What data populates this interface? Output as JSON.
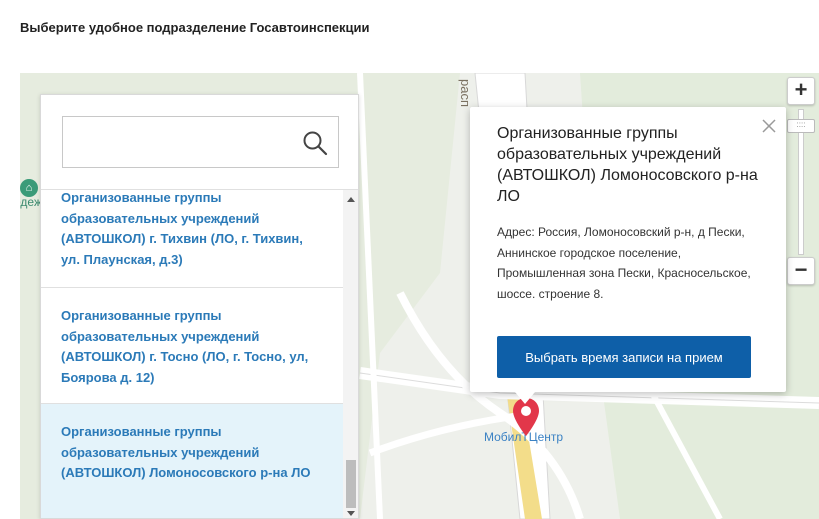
{
  "page": {
    "heading": "Выберите удобное подразделение Госавтоинспекции"
  },
  "search": {
    "value": "",
    "placeholder": ""
  },
  "list": {
    "items": [
      {
        "label": "Организованные группы образовательных учреждений (АВТОШКОЛ) г. Тихвин (ЛО, г. Тихвин, ул. Плаунская, д.3)",
        "selected": false
      },
      {
        "label": "Организованные группы образовательных учреждений (АВТОШКОЛ) г. Тосно (ЛО, г. Тосно, ул, Боярова д. 12)",
        "selected": false
      },
      {
        "label": "Организованные группы образовательных учреждений (АВТОШКОЛ) Ломоносовского р-на ЛО",
        "selected": true
      }
    ]
  },
  "popup": {
    "title": "Организованные группы образовательных учреждений (АВТОШКОЛ) Ломоносовского р-на ЛО",
    "address": "Адрес: Россия, Ломоносовский р-н, д Пески, Аннинское городское поселение, Промышленная зона Пески, Красносельское, шоссе. строение 8.",
    "button_label": "Выбрать время записи на прием"
  },
  "map": {
    "street_label": "расп",
    "poi_label": "одеж",
    "metro_label": "МобилТЦентр",
    "zoom_in": "+",
    "zoom_out": "−",
    "icons": [
      "zoom-in-icon",
      "zoom-out-icon",
      "map-pin-icon",
      "museum-icon",
      "search-icon",
      "close-icon"
    ]
  },
  "colors": {
    "link_blue": "#2b7ab8",
    "selected_bg": "#e4f3fa",
    "button_bg": "#0e5fa8",
    "pin_red": "#e2374a"
  }
}
